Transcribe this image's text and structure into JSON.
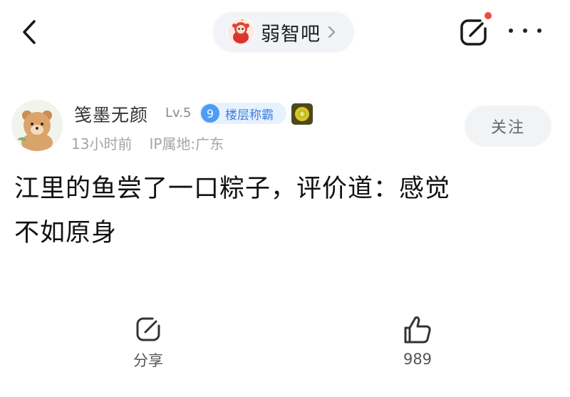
{
  "header": {
    "forum_name": "弱智吧",
    "back_icon": "back-arrow-icon",
    "edit_icon": "edit-icon",
    "more_icon": "more-icon",
    "notification_dot_color": "#f0493e"
  },
  "post": {
    "author": {
      "name": "笺墨无颜",
      "level": "Lv.5",
      "floor_rank": "9",
      "floor_title": "楼层称霸"
    },
    "time": "13小时前",
    "ip_location": "IP属地:广东",
    "follow_label": "关注",
    "content_line1": "江里的鱼尝了一口粽子，评价道：感觉",
    "content_line2": "不如原身"
  },
  "actions": {
    "share_label": "分享",
    "like_count": "989"
  }
}
